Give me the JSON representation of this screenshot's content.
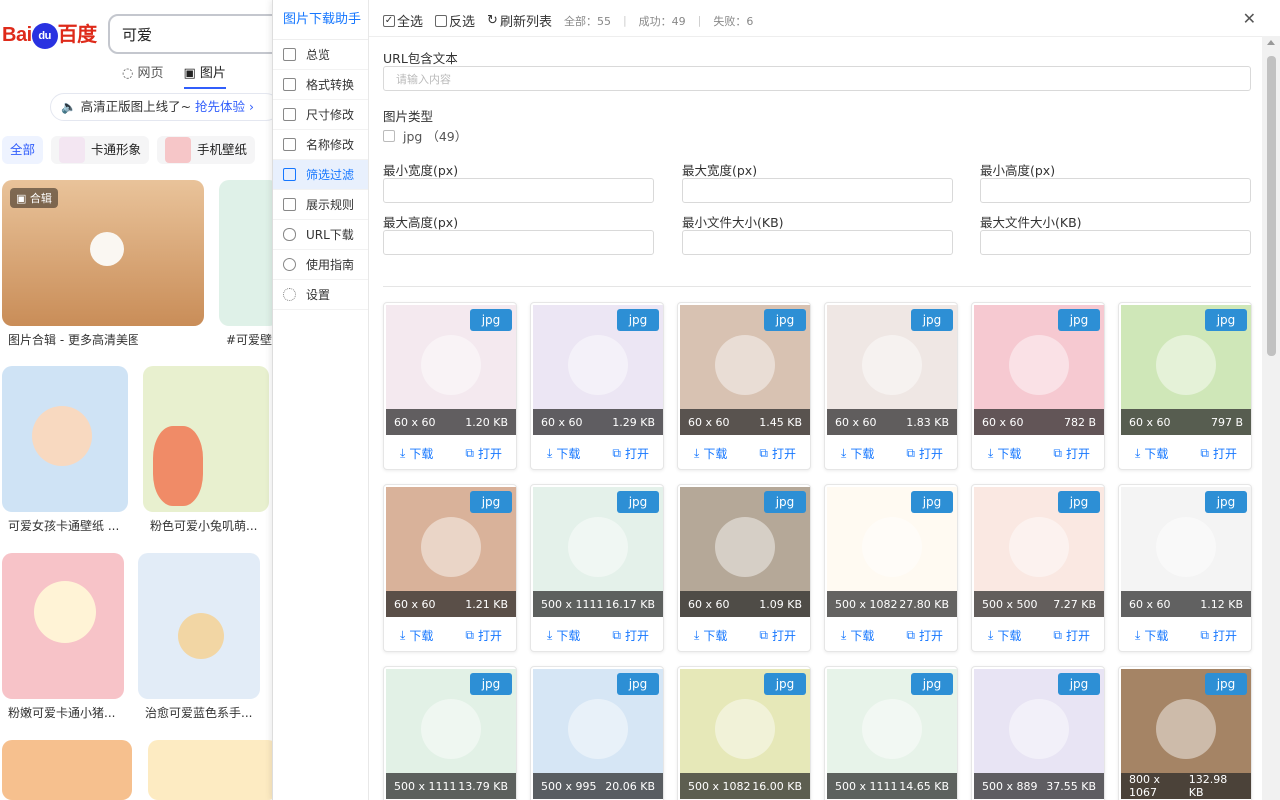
{
  "baidu": {
    "search_value": "可爱",
    "tabs": [
      "网页",
      "图片"
    ],
    "banner_text": "高清正版图上线了~",
    "banner_cta": "抢先体验 ›",
    "categories": [
      "全部",
      "卡通形象",
      "手机壁纸"
    ],
    "album_badge": "合辑",
    "captions": [
      "图片合辑 - 更多高清美图",
      "#可爱壁",
      "可爱女孩卡通壁纸 ...",
      "粉色可爱小兔叽萌...",
      "粉嫩可爱卡通小猪...",
      "治愈可爱蓝色系手..."
    ]
  },
  "extension": {
    "title": "图片下载助手",
    "nav": [
      "总览",
      "格式转换",
      "尺寸修改",
      "名称修改",
      "筛选过滤",
      "展示规则",
      "URL下载",
      "使用指南",
      "设置"
    ],
    "active_nav": "筛选过滤",
    "toolbar": {
      "select_all": "全选",
      "invert": "反选",
      "refresh": "刷新列表",
      "total_label": "全部：55",
      "success_label": "成功：49",
      "fail_label": "失败：6"
    },
    "filter": {
      "url_label": "URL包含文本",
      "url_placeholder": "请输入内容",
      "type_label": "图片类型",
      "type_option": "jpg （49）",
      "min_width": "最小宽度(px)",
      "max_width": "最大宽度(px)",
      "min_height": "最小高度(px)",
      "max_height": "最大高度(px)",
      "min_size": "最小文件大小(KB)",
      "max_size": "最大文件大小(KB)"
    },
    "card_download": "下载",
    "card_open": "打开",
    "images": [
      {
        "type": "jpg",
        "dims": "60 x 60",
        "size": "1.20 KB",
        "bg": "#f4e9ef"
      },
      {
        "type": "jpg",
        "dims": "60 x 60",
        "size": "1.29 KB",
        "bg": "#ece6f4"
      },
      {
        "type": "jpg",
        "dims": "60 x 60",
        "size": "1.45 KB",
        "bg": "#d8c2b2"
      },
      {
        "type": "jpg",
        "dims": "60 x 60",
        "size": "1.83 KB",
        "bg": "#efe7e4"
      },
      {
        "type": "jpg",
        "dims": "60 x 60",
        "size": "782 B",
        "bg": "#f6c9d1"
      },
      {
        "type": "jpg",
        "dims": "60 x 60",
        "size": "797 B",
        "bg": "#cfe7b8"
      },
      {
        "type": "jpg",
        "dims": "60 x 60",
        "size": "1.21 KB",
        "bg": "#d9b29a"
      },
      {
        "type": "jpg",
        "dims": "500 x 1111",
        "size": "16.17 KB",
        "bg": "#e4f1ea"
      },
      {
        "type": "jpg",
        "dims": "60 x 60",
        "size": "1.09 KB",
        "bg": "#b5a898"
      },
      {
        "type": "jpg",
        "dims": "500 x 1082",
        "size": "27.80 KB",
        "bg": "#fffaf2"
      },
      {
        "type": "jpg",
        "dims": "500 x 500",
        "size": "7.27 KB",
        "bg": "#fae8e2"
      },
      {
        "type": "jpg",
        "dims": "60 x 60",
        "size": "1.12 KB",
        "bg": "#f4f4f4"
      },
      {
        "type": "jpg",
        "dims": "500 x 1111",
        "size": "13.79 KB",
        "bg": "#e2f1e6"
      },
      {
        "type": "jpg",
        "dims": "500 x 995",
        "size": "20.06 KB",
        "bg": "#d6e6f5"
      },
      {
        "type": "jpg",
        "dims": "500 x 1082",
        "size": "16.00 KB",
        "bg": "#e6e8b8"
      },
      {
        "type": "jpg",
        "dims": "500 x 1111",
        "size": "14.65 KB",
        "bg": "#e7f3e9"
      },
      {
        "type": "jpg",
        "dims": "500 x 889",
        "size": "37.55 KB",
        "bg": "#e8e4f4"
      },
      {
        "type": "jpg",
        "dims": "800 x 1067",
        "size": "132.98 KB",
        "bg": "#a58465"
      }
    ]
  }
}
